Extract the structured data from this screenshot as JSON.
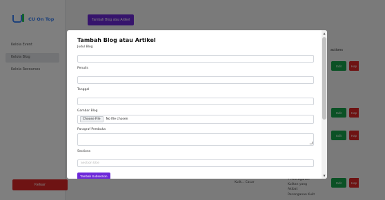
{
  "brand": {
    "name": "CU On Top"
  },
  "sidebar": {
    "items": [
      {
        "label": "Kelola Event"
      },
      {
        "label": "Kelola Blog"
      },
      {
        "label": "Kelola Recourses"
      }
    ],
    "logout_label": "Keluar"
  },
  "toolbar": {
    "add_label": "Tambah Blog atau Artikel"
  },
  "table": {
    "actions_header": "actions",
    "edit_label": "Edit",
    "delete_label": "Hap",
    "snippet_left": "Kulit... Cacar",
    "snippet_right": "• Pencegahan Kulitan yang Akibat Penanganan Kulit"
  },
  "modal": {
    "title": "Tambah Blog atau Artikel",
    "fields": {
      "title_label": "Judul Blog",
      "author_label": "Penulis",
      "date_label": "Tanggal",
      "image_label": "Gambar Blog",
      "choose_file_label": "Choose File",
      "no_file_text": "No file chosen",
      "intro_label": "Paragraf Pembuka",
      "sections_label": "Sections",
      "section_placeholder": "Section title"
    },
    "add_subsection_label": "Tambah Subsection"
  },
  "colors": {
    "primary": "#6d28d9",
    "danger": "#dc2626",
    "success": "#16a34a",
    "brand": "#3b82f6"
  }
}
